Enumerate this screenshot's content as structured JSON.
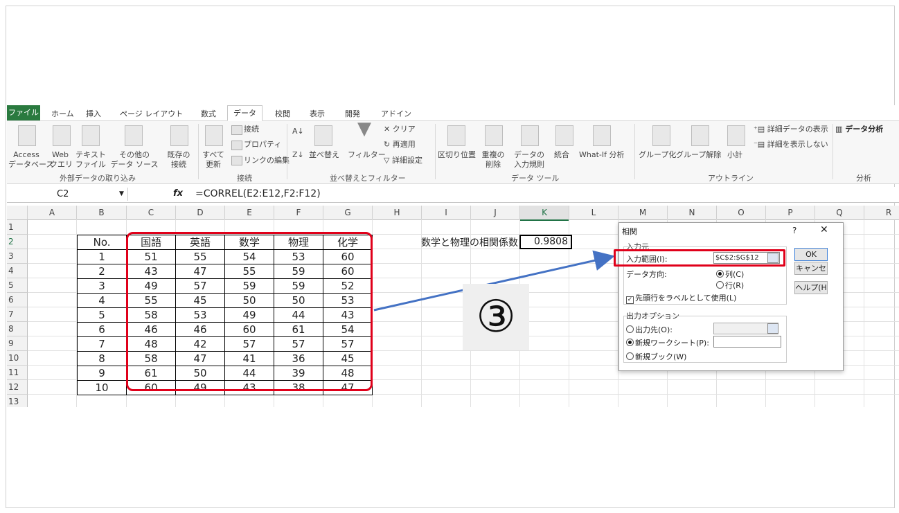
{
  "tabs": [
    "ファイル",
    "ホーム",
    "挿入",
    "ページ レイアウト",
    "数式",
    "データ",
    "校閲",
    "表示",
    "開発",
    "アドイン"
  ],
  "ribbon": {
    "access": [
      "Access",
      "データベース"
    ],
    "web": [
      "Web",
      "クエリ"
    ],
    "text": [
      "テキスト",
      "ファイル"
    ],
    "other": [
      "その他の",
      "データ ソース"
    ],
    "existing": [
      "既存の",
      "接続"
    ],
    "refresh": [
      "すべて",
      "更新"
    ],
    "conn": "接続",
    "props": "プロパティ",
    "editlinks": "リンクの編集",
    "sort": "並べ替え",
    "filter": "フィルター",
    "clear": "クリア",
    "reapply": "再適用",
    "advanced": "詳細設定",
    "split": "区切り位置",
    "dup": [
      "重複の",
      "削除"
    ],
    "valid": [
      "データの",
      "入力規則"
    ],
    "consol": "統合",
    "whatif": "What-If 分析",
    "group": "グループ化",
    "ungroup": "グループ解除",
    "subtotal": "小計",
    "showdetail": "詳細データの表示",
    "hidedetail": "詳細を表示しない",
    "analysis": "データ分析",
    "groups": [
      "外部データの取り込み",
      "接続",
      "並べ替えとフィルター",
      "データ ツール",
      "アウトライン",
      "分析"
    ]
  },
  "namebox": "C2",
  "formula": "=CORREL(E2:E12,F2:F12)",
  "fx": "fx",
  "columns": [
    "A",
    "B",
    "C",
    "D",
    "E",
    "F",
    "G",
    "H",
    "I",
    "J",
    "K",
    "L",
    "M",
    "N",
    "O",
    "P",
    "Q",
    "R"
  ],
  "rows": [
    "1",
    "2",
    "3",
    "4",
    "5",
    "6",
    "7",
    "8",
    "9",
    "10",
    "11",
    "12",
    "13"
  ],
  "table": {
    "header": [
      "No.",
      "国語",
      "英語",
      "数学",
      "物理",
      "化学"
    ],
    "rows": [
      [
        "1",
        "51",
        "55",
        "54",
        "53",
        "60"
      ],
      [
        "2",
        "43",
        "47",
        "55",
        "59",
        "60"
      ],
      [
        "3",
        "49",
        "57",
        "59",
        "59",
        "52"
      ],
      [
        "4",
        "55",
        "45",
        "50",
        "50",
        "53"
      ],
      [
        "5",
        "58",
        "53",
        "49",
        "44",
        "43"
      ],
      [
        "6",
        "46",
        "46",
        "60",
        "61",
        "54"
      ],
      [
        "7",
        "48",
        "42",
        "57",
        "57",
        "57"
      ],
      [
        "8",
        "58",
        "47",
        "41",
        "36",
        "45"
      ],
      [
        "9",
        "61",
        "50",
        "44",
        "39",
        "48"
      ],
      [
        "10",
        "60",
        "49",
        "43",
        "38",
        "47"
      ]
    ]
  },
  "corr_label": "数学と物理の相関係数",
  "corr_value": "0.9808",
  "step": "③",
  "dialog": {
    "title": "相関",
    "help": "?",
    "close": "✕",
    "input_section": "入力元",
    "input_range_label": "入力範囲(I):",
    "input_range_value": "$C$2:$G$12",
    "direction_label": "データ方向:",
    "col": "列(C)",
    "row": "行(R)",
    "labels_first": "先頭行をラベルとして使用(L)",
    "output_section": "出力オプション",
    "output_to": "出力先(O):",
    "new_sheet": "新規ワークシート(P):",
    "new_book": "新規ブック(W)",
    "ok": "OK",
    "cancel": "キャンセ",
    "helpbtn": "ヘルプ(H"
  }
}
